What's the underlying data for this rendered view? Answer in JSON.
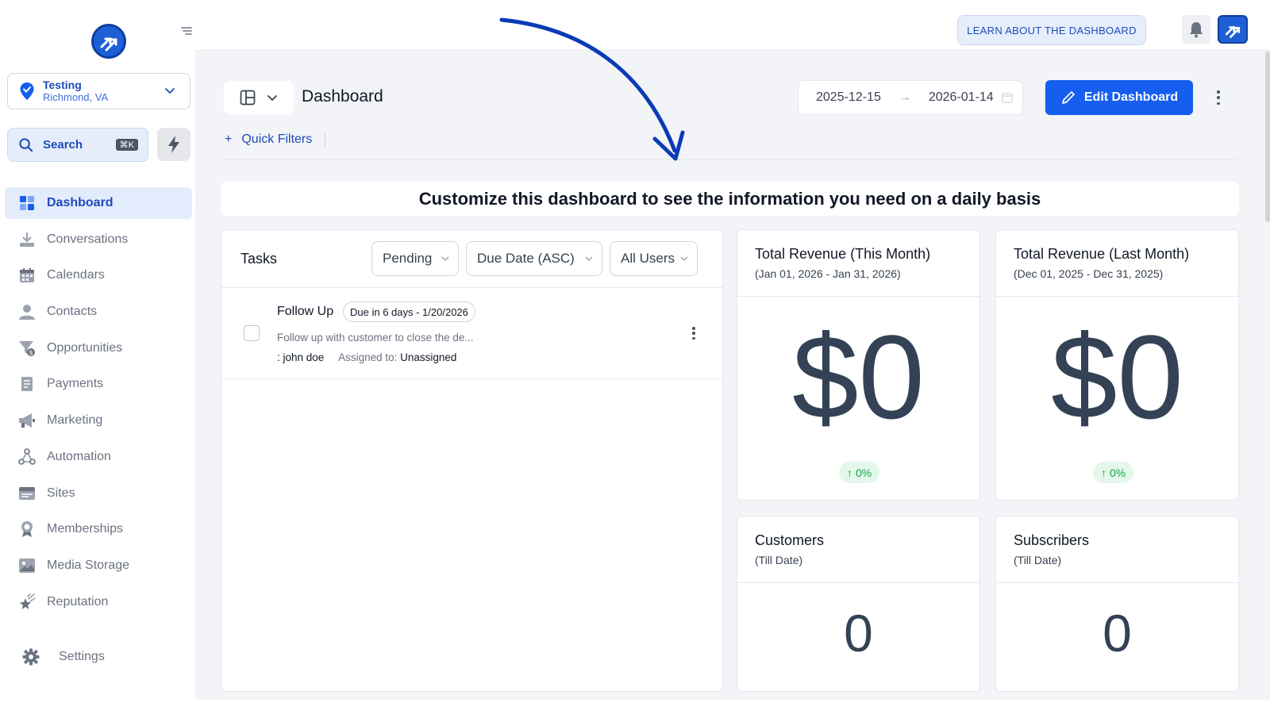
{
  "sidebar": {
    "location": {
      "name": "Testing",
      "city": "Richmond, VA"
    },
    "search": {
      "label": "Search",
      "shortcut": "⌘K"
    },
    "items": [
      {
        "label": "Dashboard"
      },
      {
        "label": "Conversations"
      },
      {
        "label": "Calendars"
      },
      {
        "label": "Contacts"
      },
      {
        "label": "Opportunities"
      },
      {
        "label": "Payments"
      },
      {
        "label": "Marketing"
      },
      {
        "label": "Automation"
      },
      {
        "label": "Sites"
      },
      {
        "label": "Memberships"
      },
      {
        "label": "Media Storage"
      },
      {
        "label": "Reputation"
      }
    ],
    "settings_label": "Settings"
  },
  "topbar": {
    "learn_label": "LEARN ABOUT THE DASHBOARD"
  },
  "header": {
    "title": "Dashboard",
    "date_start": "2025-12-15",
    "date_end": "2026-01-14",
    "edit_label": "Edit Dashboard",
    "quick_filters_label": "Quick Filters"
  },
  "banner": {
    "text": "Customize this dashboard to see the information you need on a daily basis"
  },
  "tasks": {
    "title": "Tasks",
    "filters": {
      "status": "Pending",
      "sort": "Due Date (ASC)",
      "users": "All Users"
    },
    "items": [
      {
        "name": "Follow Up",
        "due": "Due in 6 days - 1/20/2026",
        "description": "Follow up with customer to close the de...",
        "contact": ": john doe",
        "assigned_label": "Assigned to:",
        "assigned_value": "Unassigned"
      }
    ]
  },
  "cards": {
    "revenue_this": {
      "title": "Total Revenue (This Month)",
      "sub": "(Jan 01, 2026 - Jan 31, 2026)",
      "value": "$0",
      "delta": "0%"
    },
    "revenue_last": {
      "title": "Total Revenue (Last Month)",
      "sub": "(Dec 01, 2025 - Dec 31, 2025)",
      "value": "$0",
      "delta": "0%"
    },
    "customers": {
      "title": "Customers",
      "sub": "(Till Date)",
      "value": "0"
    },
    "subscribers": {
      "title": "Subscribers",
      "sub": "(Till Date)",
      "value": "0"
    }
  },
  "colors": {
    "brand": "#155eef",
    "accent_text": "#1e4bb8",
    "positive": "#16a34a",
    "value_text": "#344256"
  }
}
